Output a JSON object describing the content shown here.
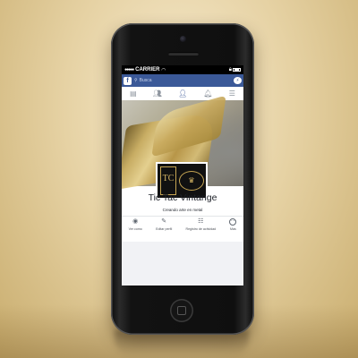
{
  "status_bar": {
    "signal": "●●●●●",
    "carrier": "CARRIER",
    "time": "",
    "wifi_icon": "wifi-icon",
    "lock_icon": "lock-icon"
  },
  "search_bar": {
    "placeholder": "Busca"
  },
  "nav_icons": [
    "news-feed-icon",
    "friends-icon",
    "profile-icon",
    "notifications-icon",
    "menu-icon"
  ],
  "page": {
    "name": "Tic Tac Vintange",
    "tagline": "Creando arte en metal",
    "logo_text": "TC"
  },
  "actions": [
    {
      "label": "Ver como",
      "icon": "eye-icon"
    },
    {
      "label": "Editar perfil",
      "icon": "edit-profile-icon"
    },
    {
      "label": "Registro de actividad",
      "icon": "activity-log-icon"
    },
    {
      "label": "Más",
      "icon": "more-icon"
    }
  ],
  "colors": {
    "brand": "#3b5998",
    "background_gold": "#e6d2a4"
  }
}
